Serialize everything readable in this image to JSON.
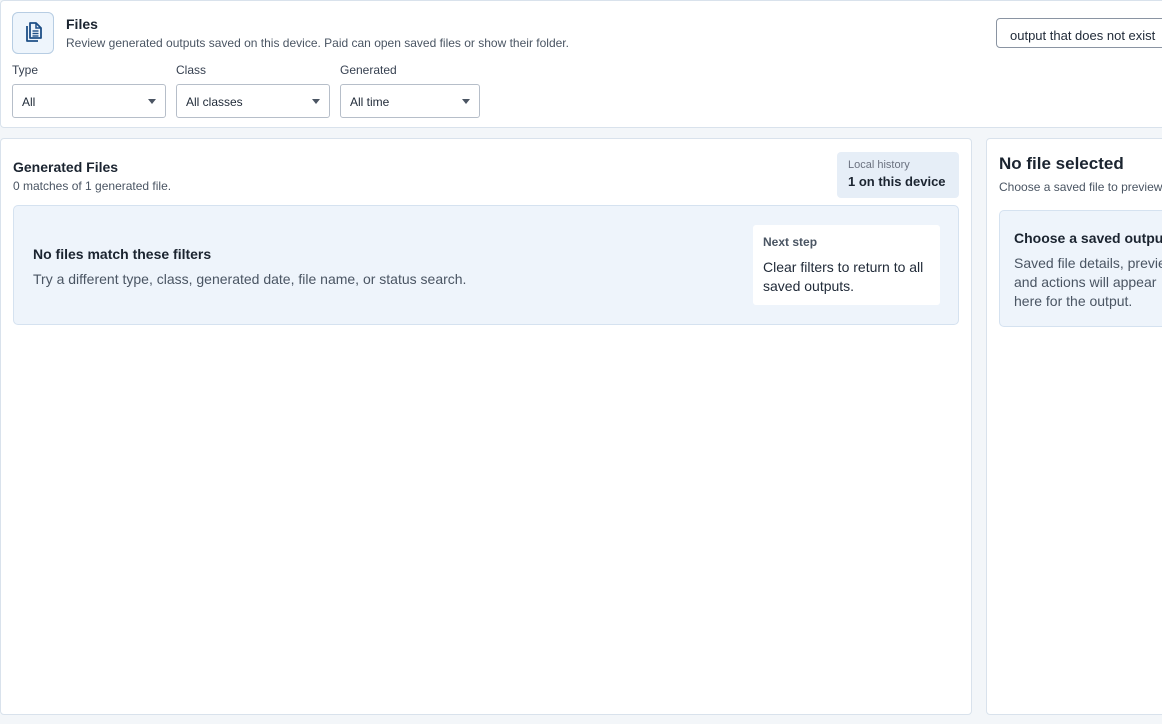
{
  "header": {
    "title": "Files",
    "subtitle": "Review generated outputs saved on this device. Paid can open saved files or show their folder.",
    "icon": "document-icon",
    "search": {
      "value": "output that does not exist"
    }
  },
  "filters": {
    "type": {
      "label": "Type",
      "value": "All"
    },
    "class": {
      "label": "Class",
      "value": "All classes"
    },
    "generated": {
      "label": "Generated",
      "value": "All time"
    }
  },
  "generated_files": {
    "title": "Generated Files",
    "count_text": "0 matches of 1 generated file.",
    "history": {
      "label": "Local history",
      "value": "1 on this device"
    },
    "empty": {
      "title": "No files match these filters",
      "description": "Try a different type, class, generated date, file name, or status search.",
      "next_step_label": "Next step",
      "next_step_text": "Clear filters to return to all saved outputs."
    }
  },
  "preview": {
    "title": "No file selected",
    "subtitle": "Choose a saved file to preview",
    "card_title": "Choose a saved output",
    "card_text": "Saved file details, preview and actions will appear here for the output."
  },
  "colors": {
    "accent": "#1e4f86",
    "panel_border": "#d9e2ec",
    "card_bg": "#eef4fb"
  }
}
